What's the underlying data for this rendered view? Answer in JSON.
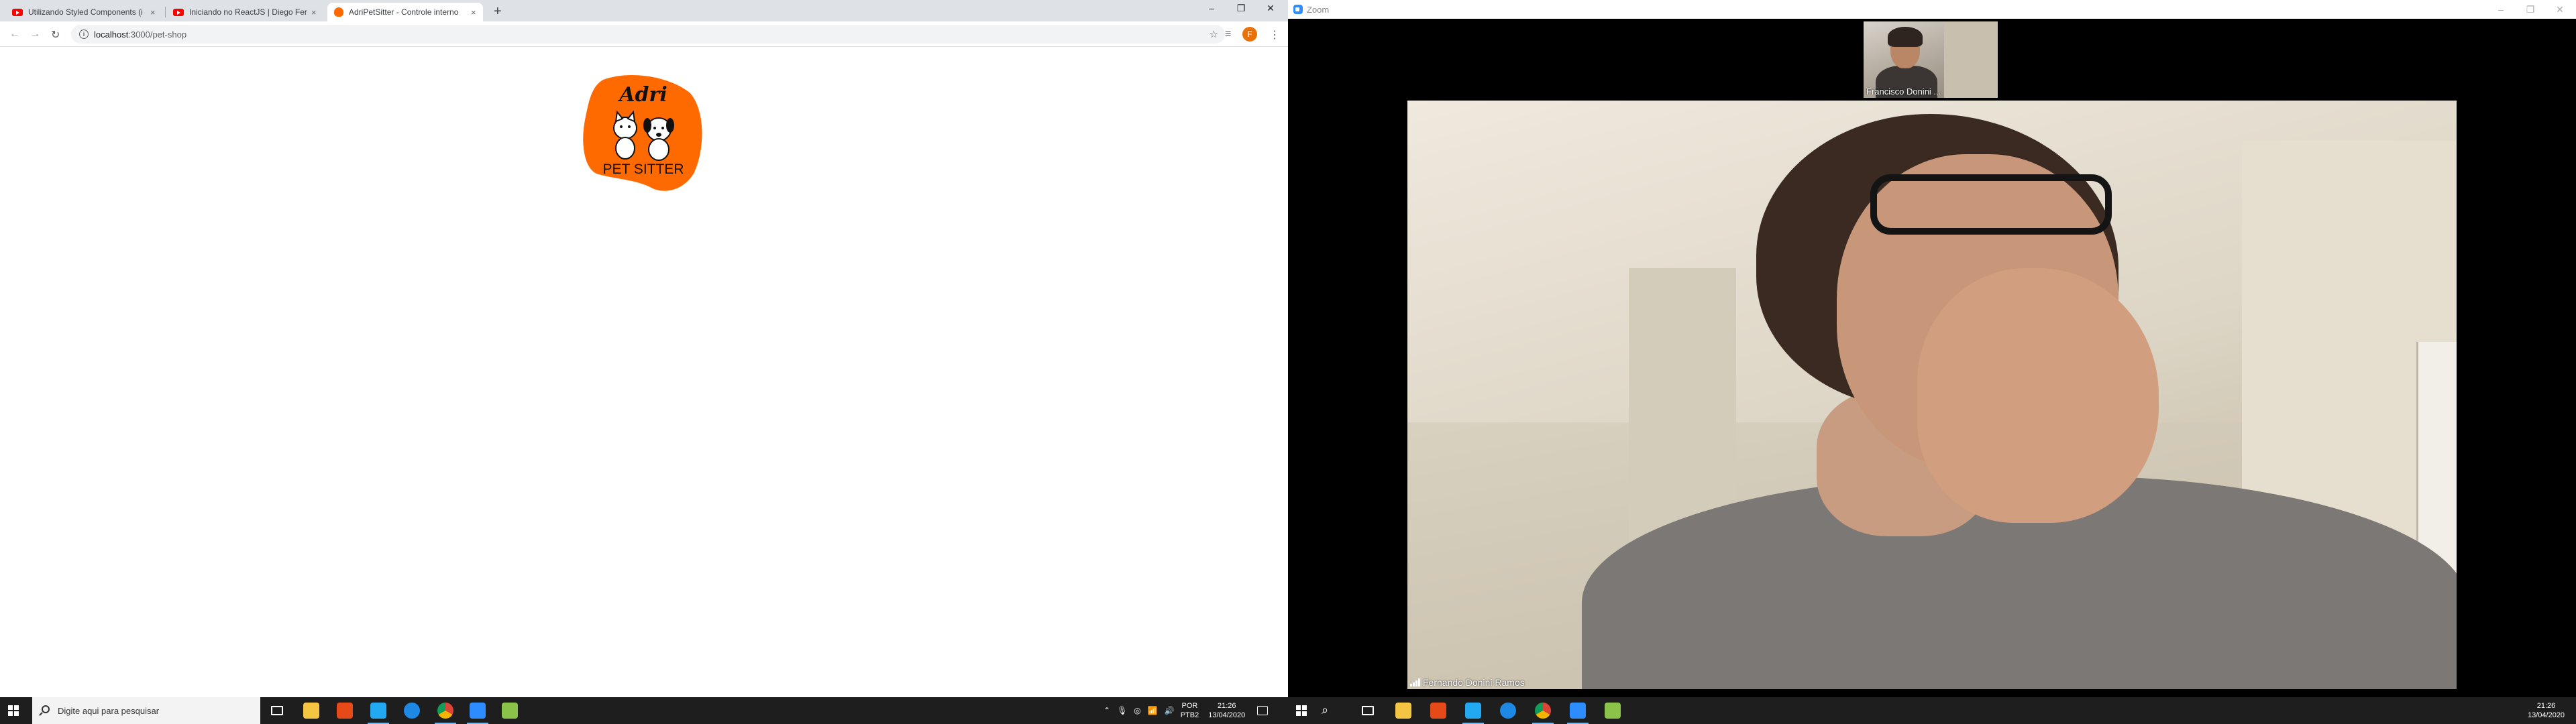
{
  "chrome": {
    "tabs": [
      {
        "title": "Utilizando Styled Components (i",
        "icon": "youtube-icon"
      },
      {
        "title": "Iniciando no ReactJS | Diego Fer",
        "icon": "youtube-icon"
      },
      {
        "title": "AdriPetSitter - Controle interno",
        "icon": "pet-favicon",
        "active": true
      }
    ],
    "close_glyph": "×",
    "new_tab_glyph": "+",
    "url_host": "localhost",
    "url_path": ":3000/pet-shop",
    "profile_initial": "F",
    "window_controls": [
      "–",
      "❐",
      "✕"
    ]
  },
  "page": {
    "logo": {
      "script_text": "Adri",
      "brand_text": "PET SITTER",
      "color": "#ff6a00"
    }
  },
  "zoom": {
    "window_title": "Zoom",
    "thumbnail_name": "Francisco Donini ...",
    "main_speaker_name": "Fernando Donini Ramos",
    "window_controls": [
      "–",
      "❐",
      "✕"
    ]
  },
  "taskbar_left": {
    "search_placeholder": "Digite aqui para pesquisar",
    "lang_top": "POR",
    "lang_bottom": "PTB2",
    "time": "21:26",
    "date": "13/04/2020"
  },
  "taskbar_right": {
    "time": "21:26",
    "date": "13/04/2020"
  },
  "colors": {
    "accent_orange": "#ff6a00",
    "zoom_blue": "#2d8cff",
    "taskbar": "#1e1e1e"
  }
}
